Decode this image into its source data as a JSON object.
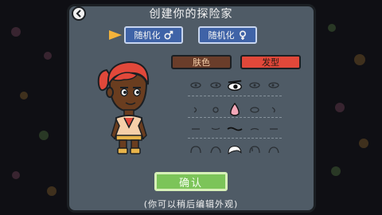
{
  "title": "创建你的探险家",
  "buttons": {
    "random_male": "随机化",
    "random_female": "随机化",
    "confirm": "确认"
  },
  "tabs": {
    "skin": "肤色",
    "hair": "发型"
  },
  "hint": "(你可以稍后编辑外观)",
  "icons": {
    "back": "back-arrow-icon",
    "male": "male-symbol-icon",
    "female": "female-symbol-icon",
    "selector": "selector-arrow-icon"
  },
  "colors": {
    "panel": "#4f5b66",
    "random_button": "#3f63a7",
    "skin_tab": "#6a3d2a",
    "hair_tab": "#e1483a",
    "confirm": "#7cc459",
    "selector_arrow": "#f4b33a"
  },
  "options": {
    "eyes_selected": 2,
    "nose_selected": 2,
    "mouth_selected": 2,
    "hair_selected": 2
  }
}
